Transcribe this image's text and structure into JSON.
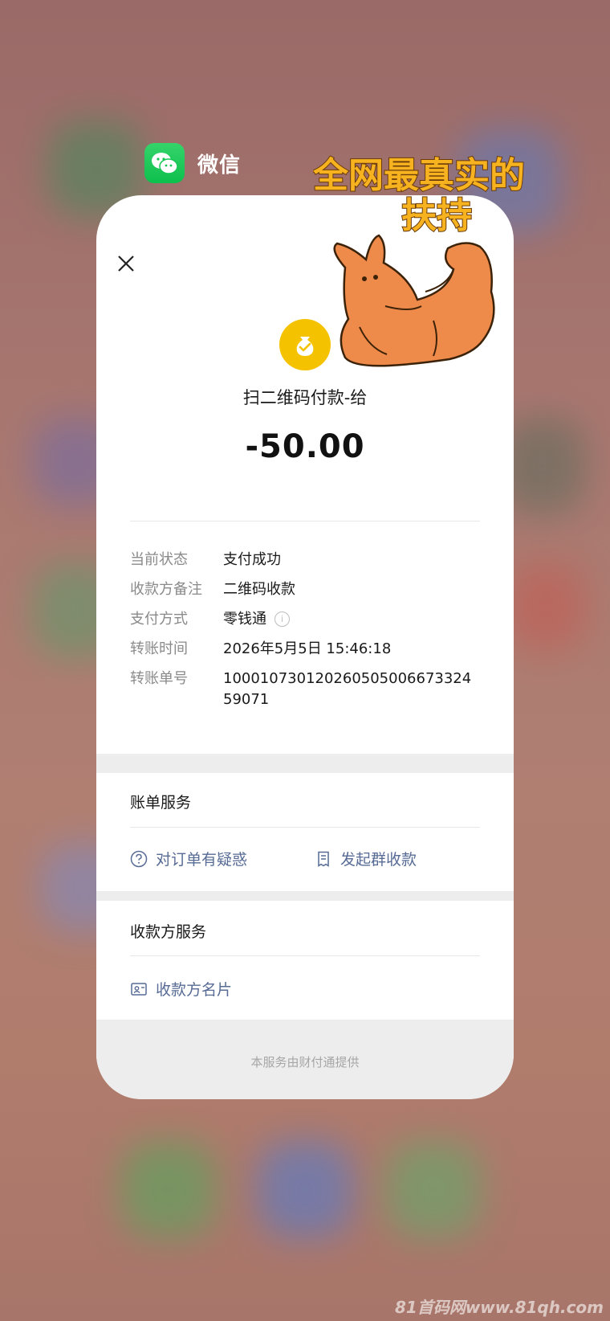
{
  "app": {
    "name": "微信",
    "icon": "wechat-icon",
    "color": "#0dbf4d"
  },
  "sticker": {
    "line1": "全网最真实的",
    "line2": "扶持"
  },
  "receipt": {
    "close_icon": "close-icon",
    "pay_icon": "coin-bag-check-icon",
    "merchant": "扫二维码付款-给",
    "amount": "-50.00",
    "details": [
      {
        "label": "当前状态",
        "value": "支付成功"
      },
      {
        "label": "收款方备注",
        "value": "二维码收款"
      },
      {
        "label": "支付方式",
        "value": "零钱通"
      },
      {
        "label": "转账时间",
        "value": "2026年5月5日 15:46:18"
      },
      {
        "label": "转账单号",
        "value": "10001073012026050500667332459071"
      }
    ],
    "bill_service": {
      "title": "账单服务",
      "question": "对订单有疑惑",
      "group_collect": "发起群收款"
    },
    "payee_service": {
      "title": "收款方服务",
      "card": "收款方名片"
    },
    "footer": "本服务由财付通提供"
  },
  "watermark": "81首码网www.81qh.com",
  "colors": {
    "accent_yellow": "#f5c200",
    "link_blue": "#576b95"
  }
}
